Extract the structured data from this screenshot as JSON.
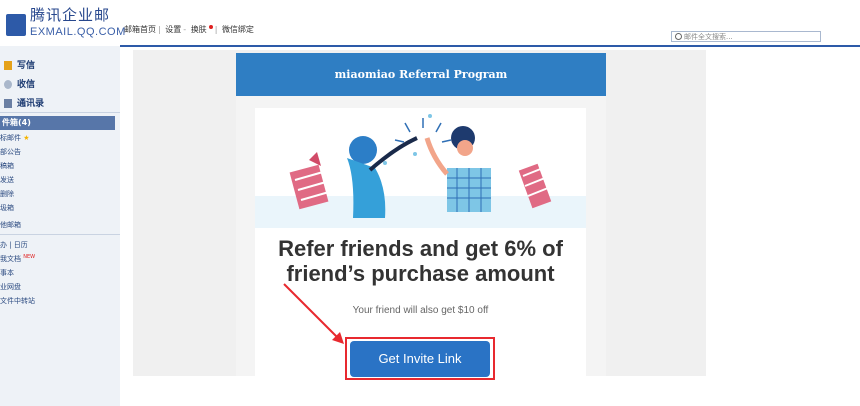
{
  "brand": {
    "name_cn": "腾讯企业邮",
    "name_en": "EXMAIL.QQ.COM"
  },
  "toplinks": [
    "邮箱首页",
    "设置",
    "换肤",
    "微信绑定"
  ],
  "search": {
    "placeholder": "邮件全文搜索..."
  },
  "sidebar": {
    "compose": "写信",
    "receive": "收信",
    "contacts": "通讯录",
    "inbox": "件箱(4)",
    "folders": [
      "标邮件",
      "部公告",
      "稿箱",
      "发送",
      "删除",
      "圾箱",
      "他邮箱"
    ],
    "tools": [
      "办 | 日历",
      "我文档",
      "事本",
      "业网盘",
      "文件中转站"
    ],
    "new_badge": "NEW"
  },
  "email": {
    "header_title": "miaomiao Referral Program",
    "headline_line1": "Refer friends and get 6% of",
    "headline_line2": "friend’s purchase amount",
    "subtext": "Your friend will also get $10 off",
    "button_label": "Get Invite Link"
  },
  "colors": {
    "brand_blue": "#2d5aa8",
    "email_header": "#2f7ec3",
    "button": "#2a73c5",
    "highlight": "#e8292f"
  }
}
